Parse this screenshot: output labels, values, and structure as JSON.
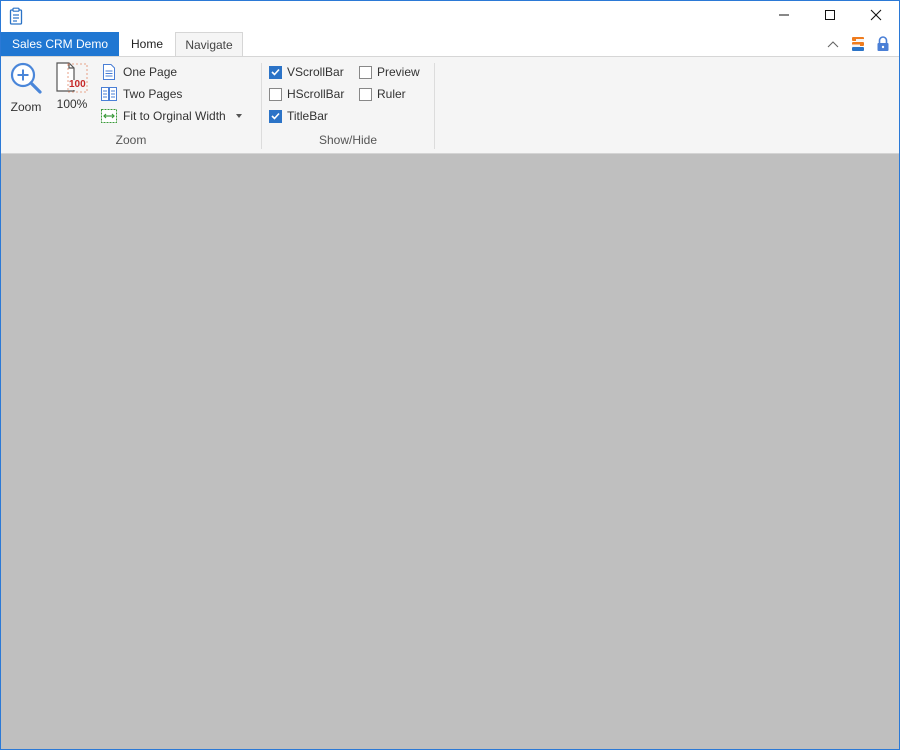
{
  "window": {
    "app_icon": "clipboard-icon",
    "controls": [
      "minimize-icon",
      "maximize-icon",
      "close-icon"
    ]
  },
  "tabs": {
    "app_tab": "Sales CRM Demo",
    "home": "Home",
    "navigate": "Navigate",
    "right_icons": [
      "chevron-up-icon",
      "skin-icon",
      "lock-icon"
    ]
  },
  "ribbon": {
    "zoom_group": {
      "label": "Zoom",
      "zoom_button": "Zoom",
      "percent_button": "100%",
      "percent_badge": "100",
      "one_page": "One Page",
      "two_pages": "Two Pages",
      "fit_width": "Fit to Orginal Width"
    },
    "showhide_group": {
      "label": "Show/Hide",
      "vscrollbar": {
        "label": "VScrollBar",
        "checked": true
      },
      "hscrollbar": {
        "label": "HScrollBar",
        "checked": false
      },
      "titlebar": {
        "label": "TitleBar",
        "checked": true
      },
      "preview": {
        "label": "Preview",
        "checked": false
      },
      "ruler": {
        "label": "Ruler",
        "checked": false
      }
    }
  },
  "colors": {
    "accent": "#2077d2",
    "content_bg": "#bfbfbf",
    "ribbon_bg": "#f5f5f5",
    "checkbox_checked": "#2b73c7"
  }
}
